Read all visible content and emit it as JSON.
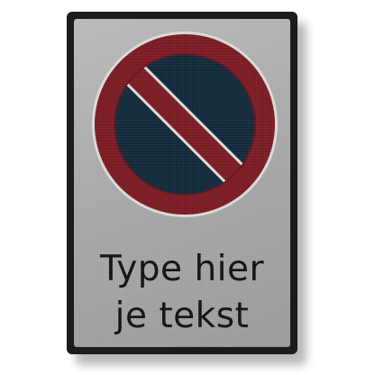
{
  "sign": {
    "line1": "Type hier",
    "line2": "je tekst",
    "symbol_icon": "no-parking-icon",
    "colors": {
      "frame": "#1c1c1c",
      "plate": "#a8a8a8",
      "ring": "#7a1a22",
      "field": "#12293a",
      "text": "#111111"
    }
  }
}
